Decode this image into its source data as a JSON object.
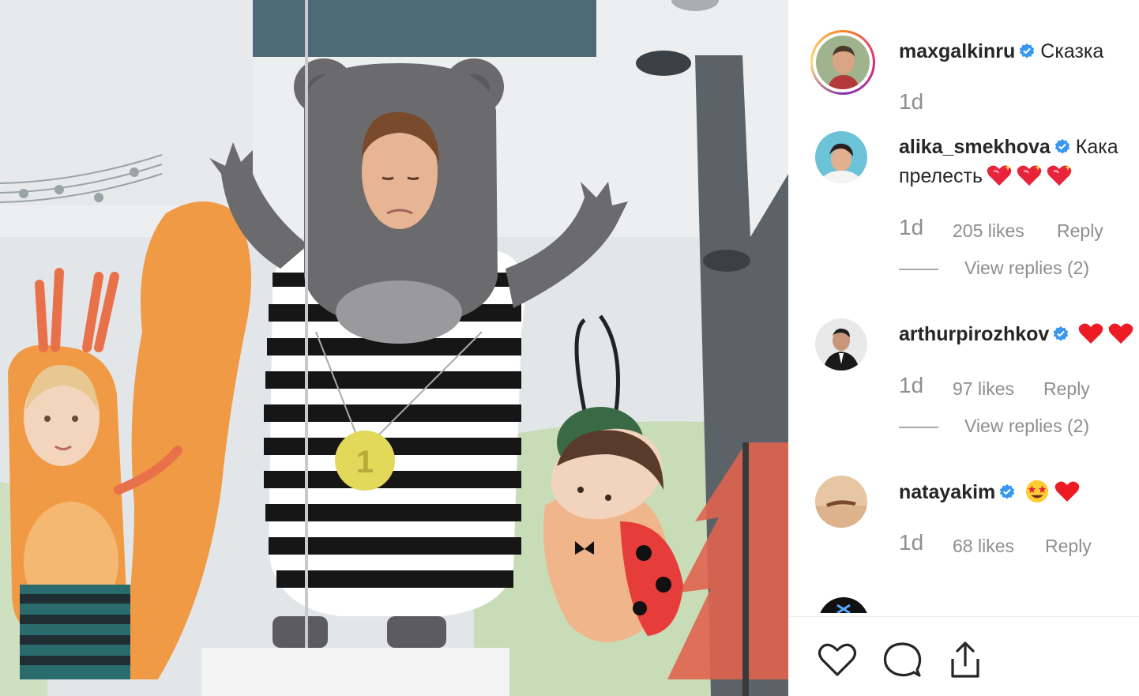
{
  "post": {
    "owner": {
      "username": "maxgalkinru",
      "caption": "Сказка",
      "time": "1d",
      "verified": true
    },
    "comments": [
      {
        "username": "alika_smekhova",
        "text_line1": "Кака",
        "text_line2": "прелесть",
        "emoji": [
          "sparkling-heart",
          "sparkling-heart",
          "sparkling-heart"
        ],
        "time": "1d",
        "likes": "205 likes",
        "reply": "Reply",
        "view_replies": "View replies (2)",
        "verified": true
      },
      {
        "username": "arthurpirozhkov",
        "text_line1": "",
        "emoji": [
          "red-heart",
          "red-heart"
        ],
        "time": "1d",
        "likes": "97 likes",
        "reply": "Reply",
        "view_replies": "View replies (2)",
        "verified": true
      },
      {
        "username": "natayakim",
        "text_line1": "",
        "emoji": [
          "star-struck",
          "red-heart"
        ],
        "time": "1d",
        "likes": "68 likes",
        "reply": "Reply",
        "verified": true
      }
    ]
  },
  "actions": [
    {
      "name": "like",
      "icon": "heart-icon"
    },
    {
      "name": "comment",
      "icon": "comment-icon"
    },
    {
      "name": "share",
      "icon": "share-icon"
    }
  ],
  "colors": {
    "verified": "#3897f0",
    "meta": "#8e8e8e",
    "heart": "#ed1c24"
  }
}
